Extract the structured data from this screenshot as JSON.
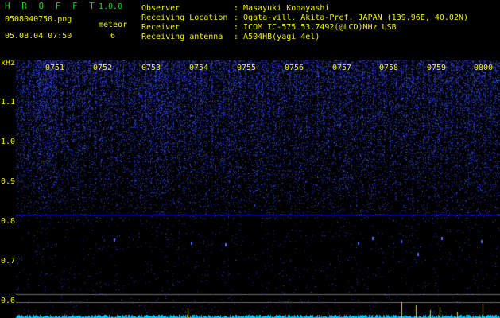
{
  "header": {
    "app_name": "H R O F F T",
    "version": "1.0.0",
    "filename": "0508040750.png",
    "datetime": "05.08.04 07:50",
    "meteor_label": "meteor",
    "meteor_count": "6"
  },
  "info": {
    "rows": [
      {
        "label": "Observer",
        "value": ": Masayuki Kobayashi"
      },
      {
        "label": "Receiving Location",
        "value": ": Ogata-vill. Akita-Pref. JAPAN (139.96E, 40.02N)"
      },
      {
        "label": "Receiver",
        "value": ": ICOM IC-575 53.7492(@LCD)MHz USB"
      },
      {
        "label": "Receiving antenna",
        "value": ": A504HB(yagi 4el)"
      }
    ]
  },
  "axis": {
    "unit": "kHz",
    "y_ticks": [
      "1.1",
      "1.0",
      "0.9",
      "0.8",
      "0.7",
      "0.6"
    ],
    "time_ticks": [
      "0751",
      "0752",
      "0753",
      "0754",
      "0755",
      "0756",
      "0757",
      "0758",
      "0759",
      "0800"
    ]
  },
  "colors": {
    "background": "#000000",
    "label_yellow": "#f2f200",
    "label_green": "#00e000",
    "signal_blue": "#2a3cff",
    "trace_cyan": "#00e0ff"
  }
}
